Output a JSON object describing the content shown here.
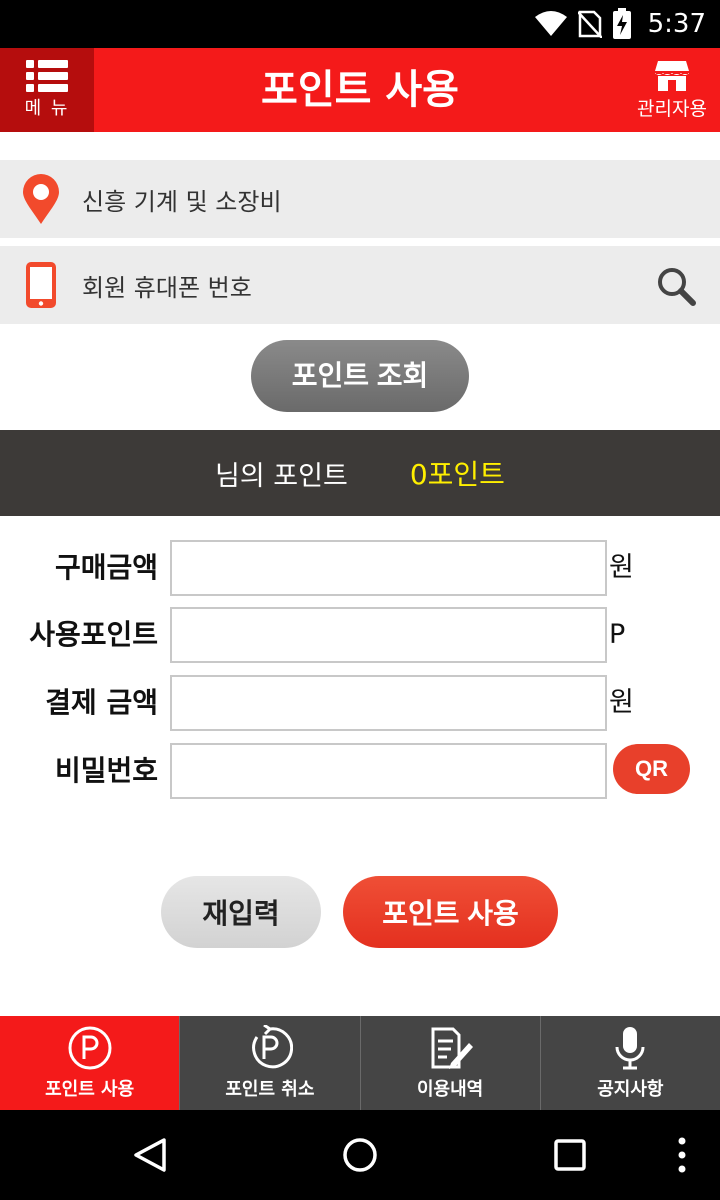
{
  "status_bar": {
    "time": "5:37"
  },
  "header": {
    "menu_label": "메 뉴",
    "title": "포인트 사용",
    "admin_label": "관리자용"
  },
  "store": {
    "name": "신흥 기계 및 소장비"
  },
  "phone": {
    "placeholder": "회원 휴대폰 번호"
  },
  "inquiry_button": "포인트 조회",
  "points": {
    "owner_label": "님의 포인트",
    "value": "0포인트"
  },
  "form": {
    "purchase_amount": {
      "label": "구매금액",
      "value": "",
      "unit": "원"
    },
    "use_points": {
      "label": "사용포인트",
      "value": "",
      "unit": "P"
    },
    "payment_amount": {
      "label": "결제 금액",
      "value": "",
      "unit": "원"
    },
    "password": {
      "label": "비밀번호",
      "value": ""
    },
    "qr_label": "QR"
  },
  "actions": {
    "reset": "재입력",
    "use": "포인트 사용"
  },
  "tabs": [
    {
      "label": "포인트 사용",
      "icon": "p-circle-icon",
      "active": true
    },
    {
      "label": "포인트 취소",
      "icon": "p-cancel-icon",
      "active": false
    },
    {
      "label": "이용내역",
      "icon": "history-icon",
      "active": false
    },
    {
      "label": "공지사항",
      "icon": "microphone-icon",
      "active": false
    }
  ],
  "colors": {
    "brand_red": "#f41a1a",
    "menu_dark_red": "#b50d0d",
    "point_value": "#ffef00",
    "band_bg": "#3d3a38",
    "accent_orange": "#e8402b"
  }
}
